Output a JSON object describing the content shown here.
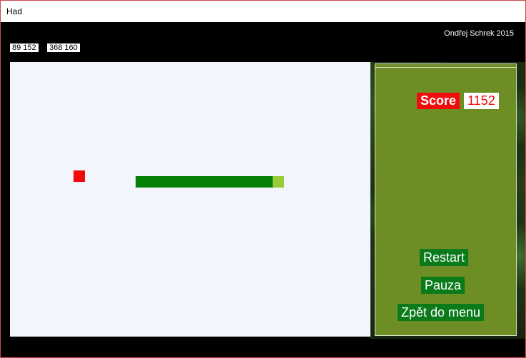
{
  "window": {
    "title": "Had"
  },
  "header": {
    "author": "Ondřej Schrek 2015"
  },
  "coords": [
    {
      "text": "89 152"
    },
    {
      "text": "368 160"
    }
  ],
  "score": {
    "label": "Score",
    "value": "1152"
  },
  "buttons": {
    "restart": "Restart",
    "pause": "Pauza",
    "menu": "Zpět do menu"
  },
  "colors": {
    "food": "#f10a0a",
    "snake_body": "#078007",
    "snake_head": "#98cb36",
    "panel": "#6c8e25",
    "button": "#0a7a1b"
  }
}
